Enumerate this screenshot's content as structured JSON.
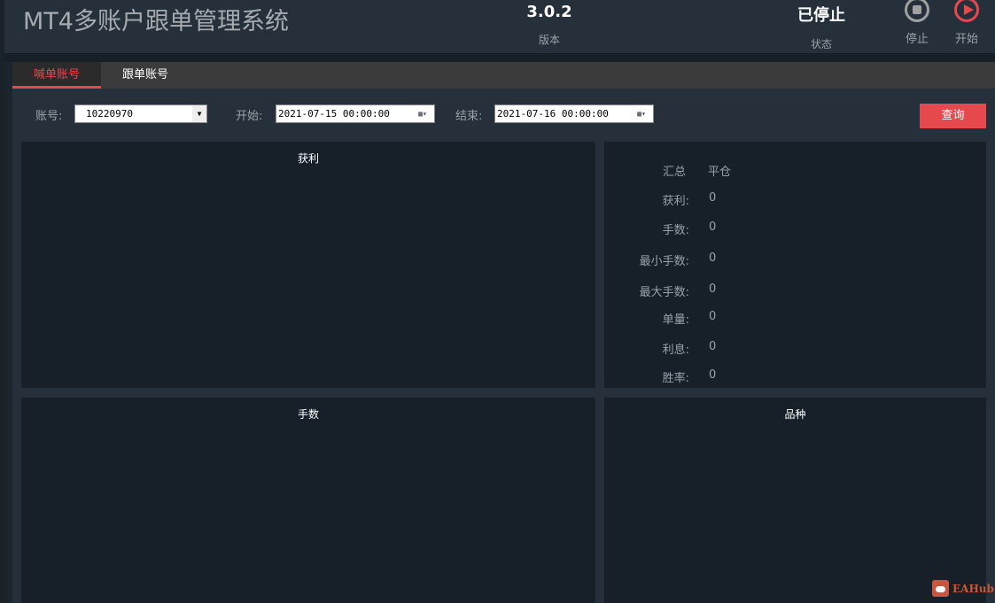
{
  "header": {
    "title": "MT4多账户跟单管理系统",
    "version": "3.0.2",
    "version_label": "版本",
    "status": "已停止",
    "status_label": "状态",
    "stop_label": "停止",
    "start_label": "开始"
  },
  "colors": {
    "accent": "#e5484d"
  },
  "tabs": [
    {
      "label": "喊单账号",
      "active": true
    },
    {
      "label": "跟单账号",
      "active": false
    }
  ],
  "filters": {
    "account_label": "账号:",
    "account_value": "10220970",
    "start_label": "开始:",
    "start_value": "2021-07-15 00:00:00",
    "end_label": "结束:",
    "end_value": "2021-07-16 00:00:00",
    "query_label": "查询"
  },
  "panels": {
    "profit_title": "获利",
    "lots_title": "手数",
    "symbol_title": "品种"
  },
  "summary": {
    "header_key": "汇总",
    "header_val": "平仓",
    "rows": [
      {
        "k": "获利:",
        "v": "0"
      },
      {
        "k": "手数:",
        "v": "0"
      },
      {
        "k": "最小手数:",
        "v": "0"
      },
      {
        "k": "最大手数:",
        "v": "0"
      },
      {
        "k": "单量:",
        "v": "0"
      },
      {
        "k": "利息:",
        "v": "0"
      },
      {
        "k": "胜率:",
        "v": "0"
      }
    ]
  },
  "watermark": "EAHub"
}
